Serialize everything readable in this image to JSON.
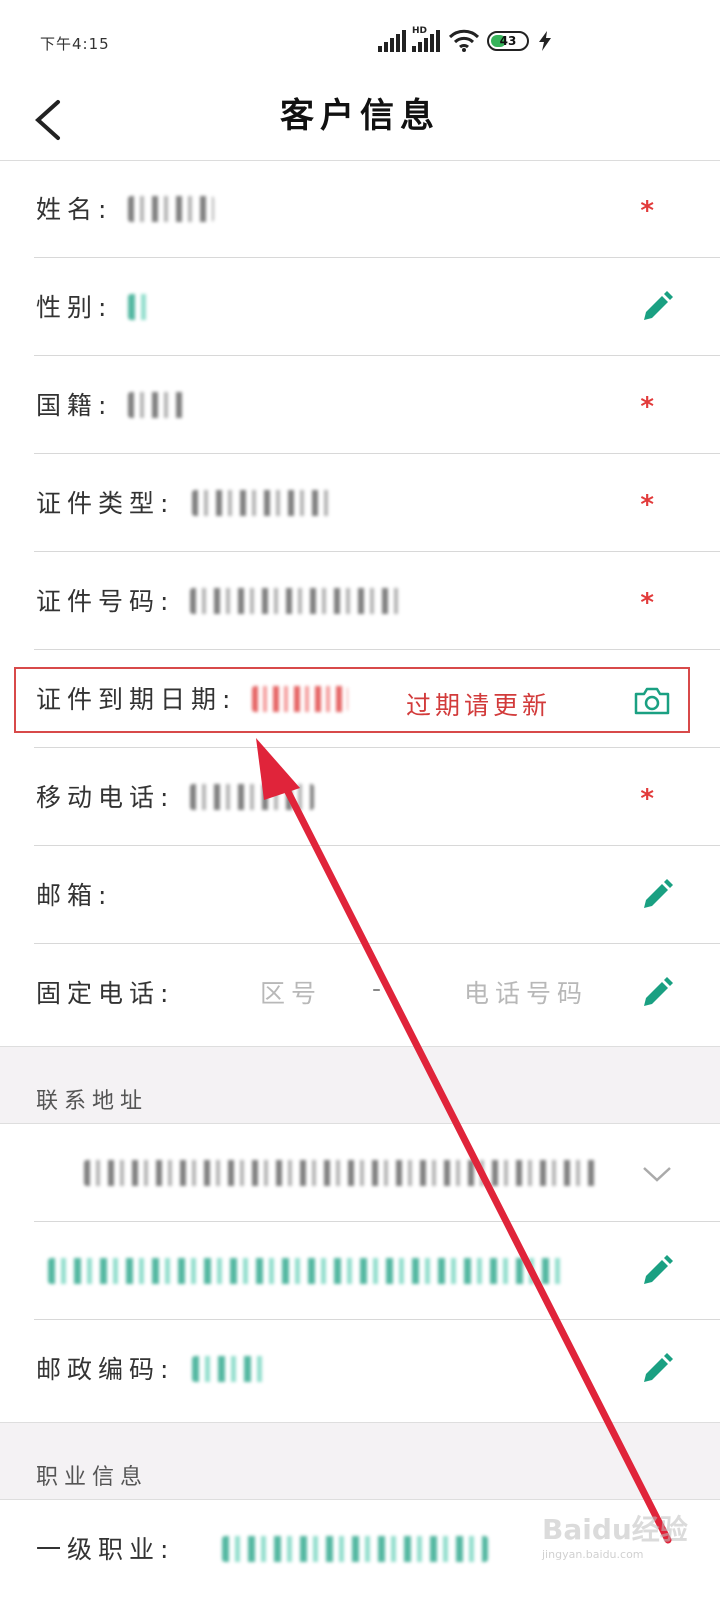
{
  "status_bar": {
    "time": "下午4:15",
    "battery_percent": 43,
    "battery_text": "43",
    "network_label": "HD"
  },
  "header": {
    "title": "客户信息"
  },
  "fields": {
    "name": {
      "label": "姓名:"
    },
    "gender": {
      "label": "性别:"
    },
    "nationality": {
      "label": "国籍:"
    },
    "id_type": {
      "label": "证件类型:"
    },
    "id_number": {
      "label": "证件号码:"
    },
    "id_expiry": {
      "label": "证件到期日期:",
      "note": "过期请更新"
    },
    "mobile": {
      "label": "移动电话:"
    },
    "email": {
      "label": "邮箱:"
    },
    "landline": {
      "label": "固定电话:",
      "area_placeholder": "区号",
      "separator": "-",
      "number_placeholder": "电话号码"
    },
    "postal_code": {
      "label": "邮政编码:"
    },
    "occupation_level1": {
      "label": "一级职业:"
    }
  },
  "sections": {
    "address": "联系地址",
    "occupation": "职业信息"
  },
  "required_mark": "*",
  "watermark": {
    "brand": "Baidu经验",
    "url": "jingyan.baidu.com"
  },
  "colors": {
    "accent_teal": "#1aa082",
    "required_red": "#e23b3b",
    "annotation_red": "#e0243a"
  }
}
